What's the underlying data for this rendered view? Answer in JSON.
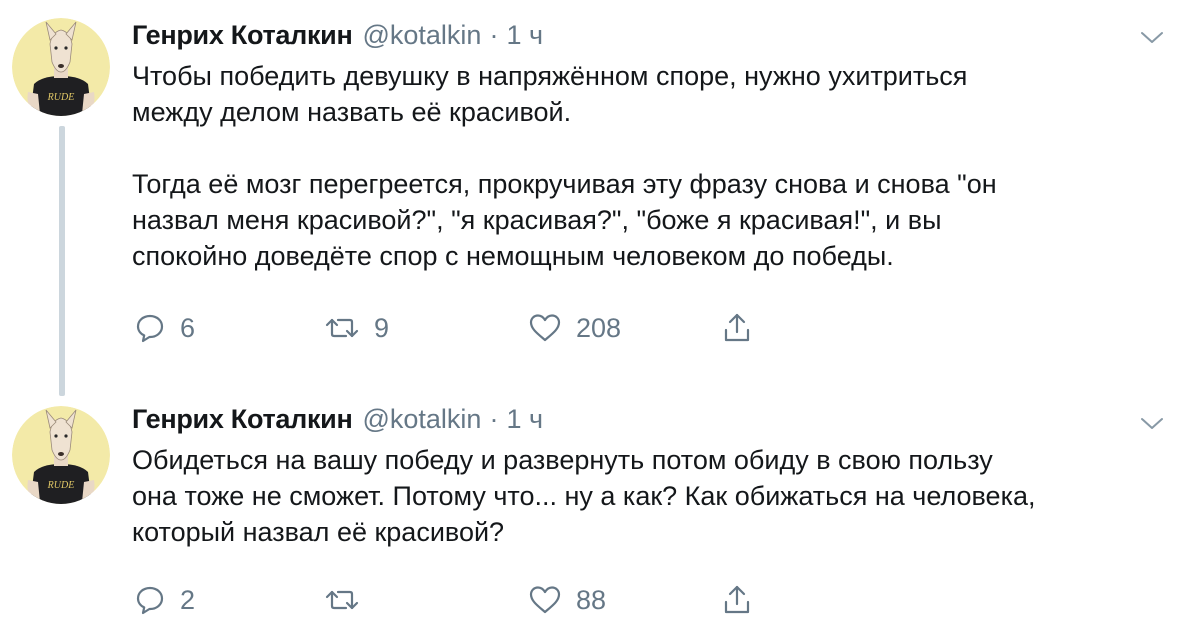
{
  "tweets": [
    {
      "author": {
        "name": "Генрих Коталкин",
        "handle": "@kotalkin",
        "time": "1 ч",
        "separator": "·"
      },
      "text": "Чтобы победить девушку в напряжённом споре, нужно ухитриться\nмежду делом назвать её красивой.\n\nТогда её мозг перегреется, прокручивая эту фразу снова и снова \"он\nназвал меня красивой?\", \"я красивая?\", \"боже я красивая!\", и вы\nспокойно доведёте спор с немощным человеком до победы.",
      "stats": {
        "replies": "6",
        "retweets": "9",
        "likes": "208"
      },
      "avatar": {
        "shirt_text": "RUDE",
        "bg": "#f3eaa8"
      },
      "icons": {
        "menu": "chevron-down-icon",
        "reply": "reply-icon",
        "retweet": "retweet-icon",
        "like": "heart-icon",
        "share": "share-icon"
      }
    },
    {
      "author": {
        "name": "Генрих Коталкин",
        "handle": "@kotalkin",
        "time": "1 ч",
        "separator": "·"
      },
      "text": "Обидеться на вашу победу и развернуть потом обиду в свою пользу\nона тоже не сможет. Потому что... ну а как? Как обижаться на человека,\nкоторый назвал её красивой?",
      "stats": {
        "replies": "2",
        "retweets": "",
        "likes": "88"
      },
      "avatar": {
        "shirt_text": "RUDE",
        "bg": "#f3eaa8"
      },
      "icons": {
        "menu": "chevron-down-icon",
        "reply": "reply-icon",
        "retweet": "retweet-icon",
        "like": "heart-icon",
        "share": "share-icon"
      }
    }
  ],
  "colors": {
    "text": "#14171a",
    "secondary": "#657786",
    "thread_line": "#ccd6dd",
    "background": "#ffffff"
  }
}
